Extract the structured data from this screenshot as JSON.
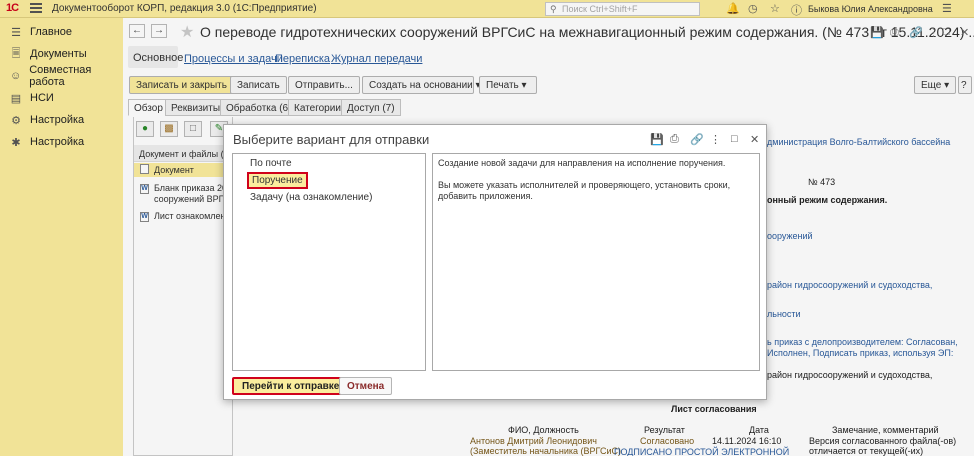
{
  "app": {
    "logo": "1C",
    "title": "Документооборот КОРП, редакция 3.0  (1С:Предприятие)",
    "search_placeholder": "Поиск Ctrl+Shift+F",
    "user": "Быкова Юлия Александровна"
  },
  "sidebar": {
    "items": [
      {
        "label": "Главное",
        "icon": "menu-icon"
      },
      {
        "label": "Документы",
        "icon": "documents-icon"
      },
      {
        "label": "Совместная работа",
        "icon": "people-icon"
      },
      {
        "label": "НСИ",
        "icon": "book-icon"
      },
      {
        "label": "Настройка",
        "icon": "gear-icon"
      },
      {
        "label": "Настройка",
        "icon": "gear-tools-icon"
      }
    ]
  },
  "document": {
    "title": "О переводе гидротехнических сооружений  ВРГСиС на межнавигационный режим содержания. (№ 473 от 15.11.2024) ...",
    "links": [
      "Основное",
      "Процессы и задачи",
      "Переписка",
      "Журнал передачи"
    ],
    "toolbar": {
      "save_close": "Записать и закрыть",
      "save": "Записать",
      "send": "Отправить...",
      "create_basis": "Создать на основании",
      "print": "Печать",
      "more": "Еще"
    },
    "subtabs": [
      "Обзор",
      "Реквизиты",
      "Обработка (6)",
      "Категории",
      "Доступ (7)"
    ],
    "files_header": "Документ и файлы (2",
    "files": [
      "Документ",
      "Бланк приказа 20",
      "сооружений  ВРГ",
      "Лист ознакомлен"
    ]
  },
  "preview": {
    "lines": [
      "дминистрация Волго-Балтийского бассейна",
      "№ 473",
      "онный режим содержания.",
      "ооружений",
      "район гидросооружений и судоходства,",
      "льности",
      "ь приказ с делопроизводителем: Согласован,",
      "Исполнен, Подписать приказ, используя ЭП:",
      "район гидросооружений и судоходства,"
    ],
    "sheet_title": "Лист согласования",
    "columns": [
      "ФИО, Должность",
      "Результат",
      "Дата",
      "Замечание, комментарий"
    ],
    "row": {
      "name": "Антонов Дмитрий Леонидович",
      "position": "(Заместитель начальника (ВРГСиС)",
      "result": "Согласовано",
      "date": "14.11.2024 16:10",
      "comment": "Версия согласованного файла(-ов)",
      "comment2": "отличается от текущей(-их)",
      "signed": "ПОДПИСАНО ПРОСТОЙ ЭЛЕКТРОННОЙ"
    }
  },
  "dialog": {
    "title": "Выберите вариант для отправки",
    "options": [
      "По почте",
      "Поручение",
      "Задачу (на ознакомление)"
    ],
    "description": [
      "Создание новой задачи для направления на исполнение поручения.",
      "Вы можете указать исполнителей и проверяющего, установить сроки, добавить приложения."
    ],
    "go_button": "Перейти к отправке",
    "cancel_button": "Отмена"
  }
}
